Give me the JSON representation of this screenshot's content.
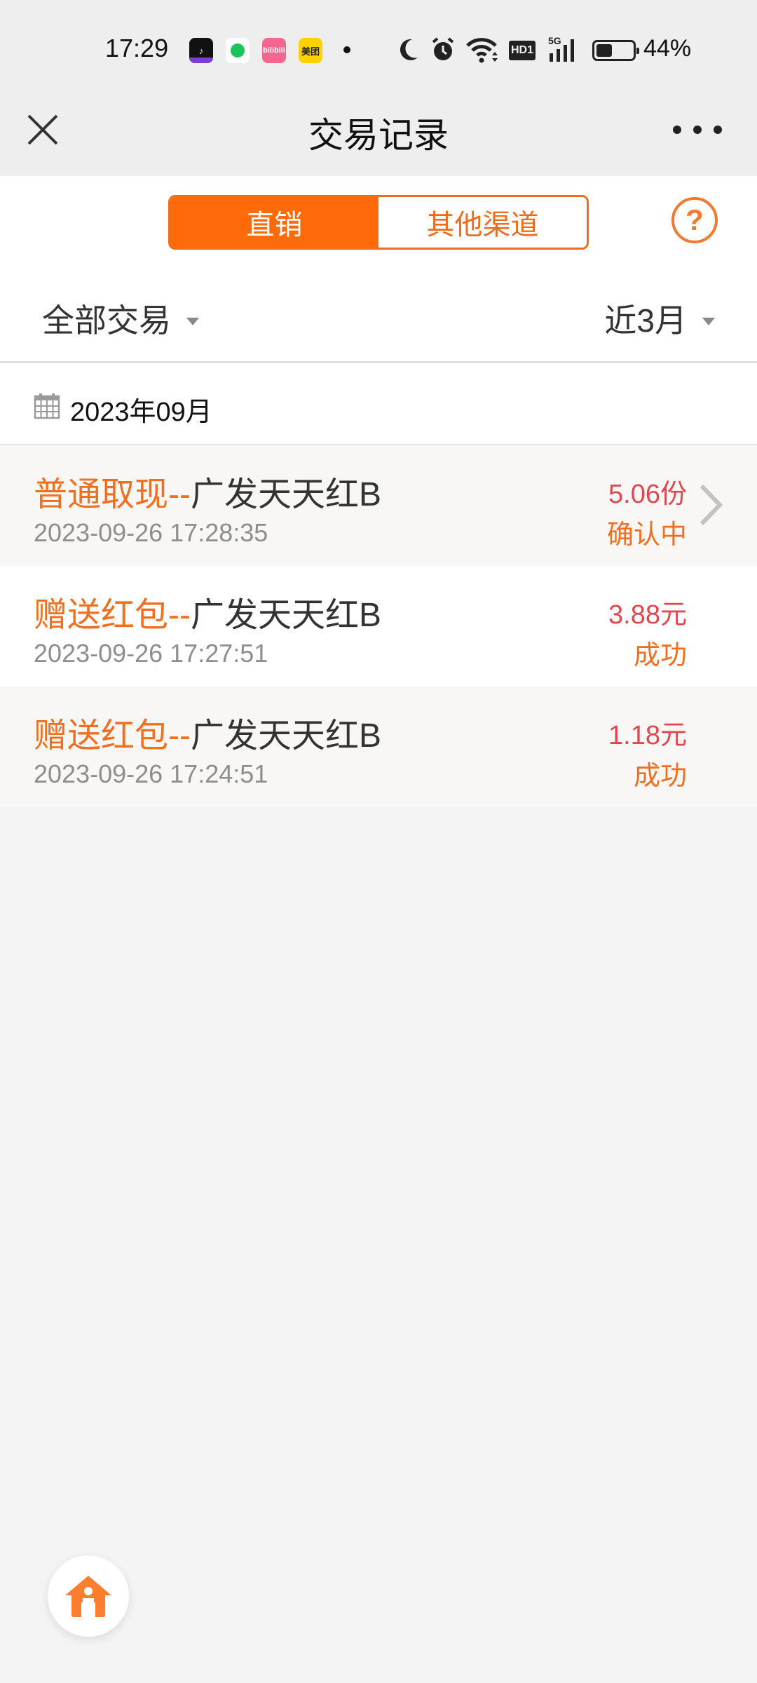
{
  "status_bar": {
    "time": "17:29",
    "notification_apps": [
      "tiktok-icon",
      "green-app-icon",
      "bilibili-icon",
      "meituan-icon"
    ],
    "meituan_label": "美团",
    "bilibili_label": "bilibili",
    "network_label": "HD1",
    "signal_label": "5G",
    "battery_percent": "44%",
    "battery_level": 0.44
  },
  "nav": {
    "title": "交易记录",
    "close_icon": "close-icon",
    "more_icon": "more-icon"
  },
  "tabs": {
    "items": [
      {
        "label": "直销",
        "active": true
      },
      {
        "label": "其他渠道",
        "active": false
      }
    ],
    "help_symbol": "?"
  },
  "filters": {
    "type_label": "全部交易",
    "period_label": "近3月"
  },
  "month": {
    "label": "2023年09月"
  },
  "transactions": [
    {
      "type": "普通取现--",
      "fund": "广发天天红B",
      "time": "2023-09-26 17:28:35",
      "amount": "5.06份",
      "status": "确认中",
      "has_detail": true
    },
    {
      "type": "赠送红包--",
      "fund": "广发天天红B",
      "time": "2023-09-26 17:27:51",
      "amount": "3.88元",
      "status": "成功",
      "has_detail": false
    },
    {
      "type": "赠送红包--",
      "fund": "广发天天红B",
      "time": "2023-09-26 17:24:51",
      "amount": "1.18元",
      "status": "成功",
      "has_detail": false
    }
  ],
  "colors": {
    "accent": "#ff6a0a",
    "amount": "#e0484f",
    "status": "#f07020",
    "page_bg": "#f4f4f4"
  }
}
